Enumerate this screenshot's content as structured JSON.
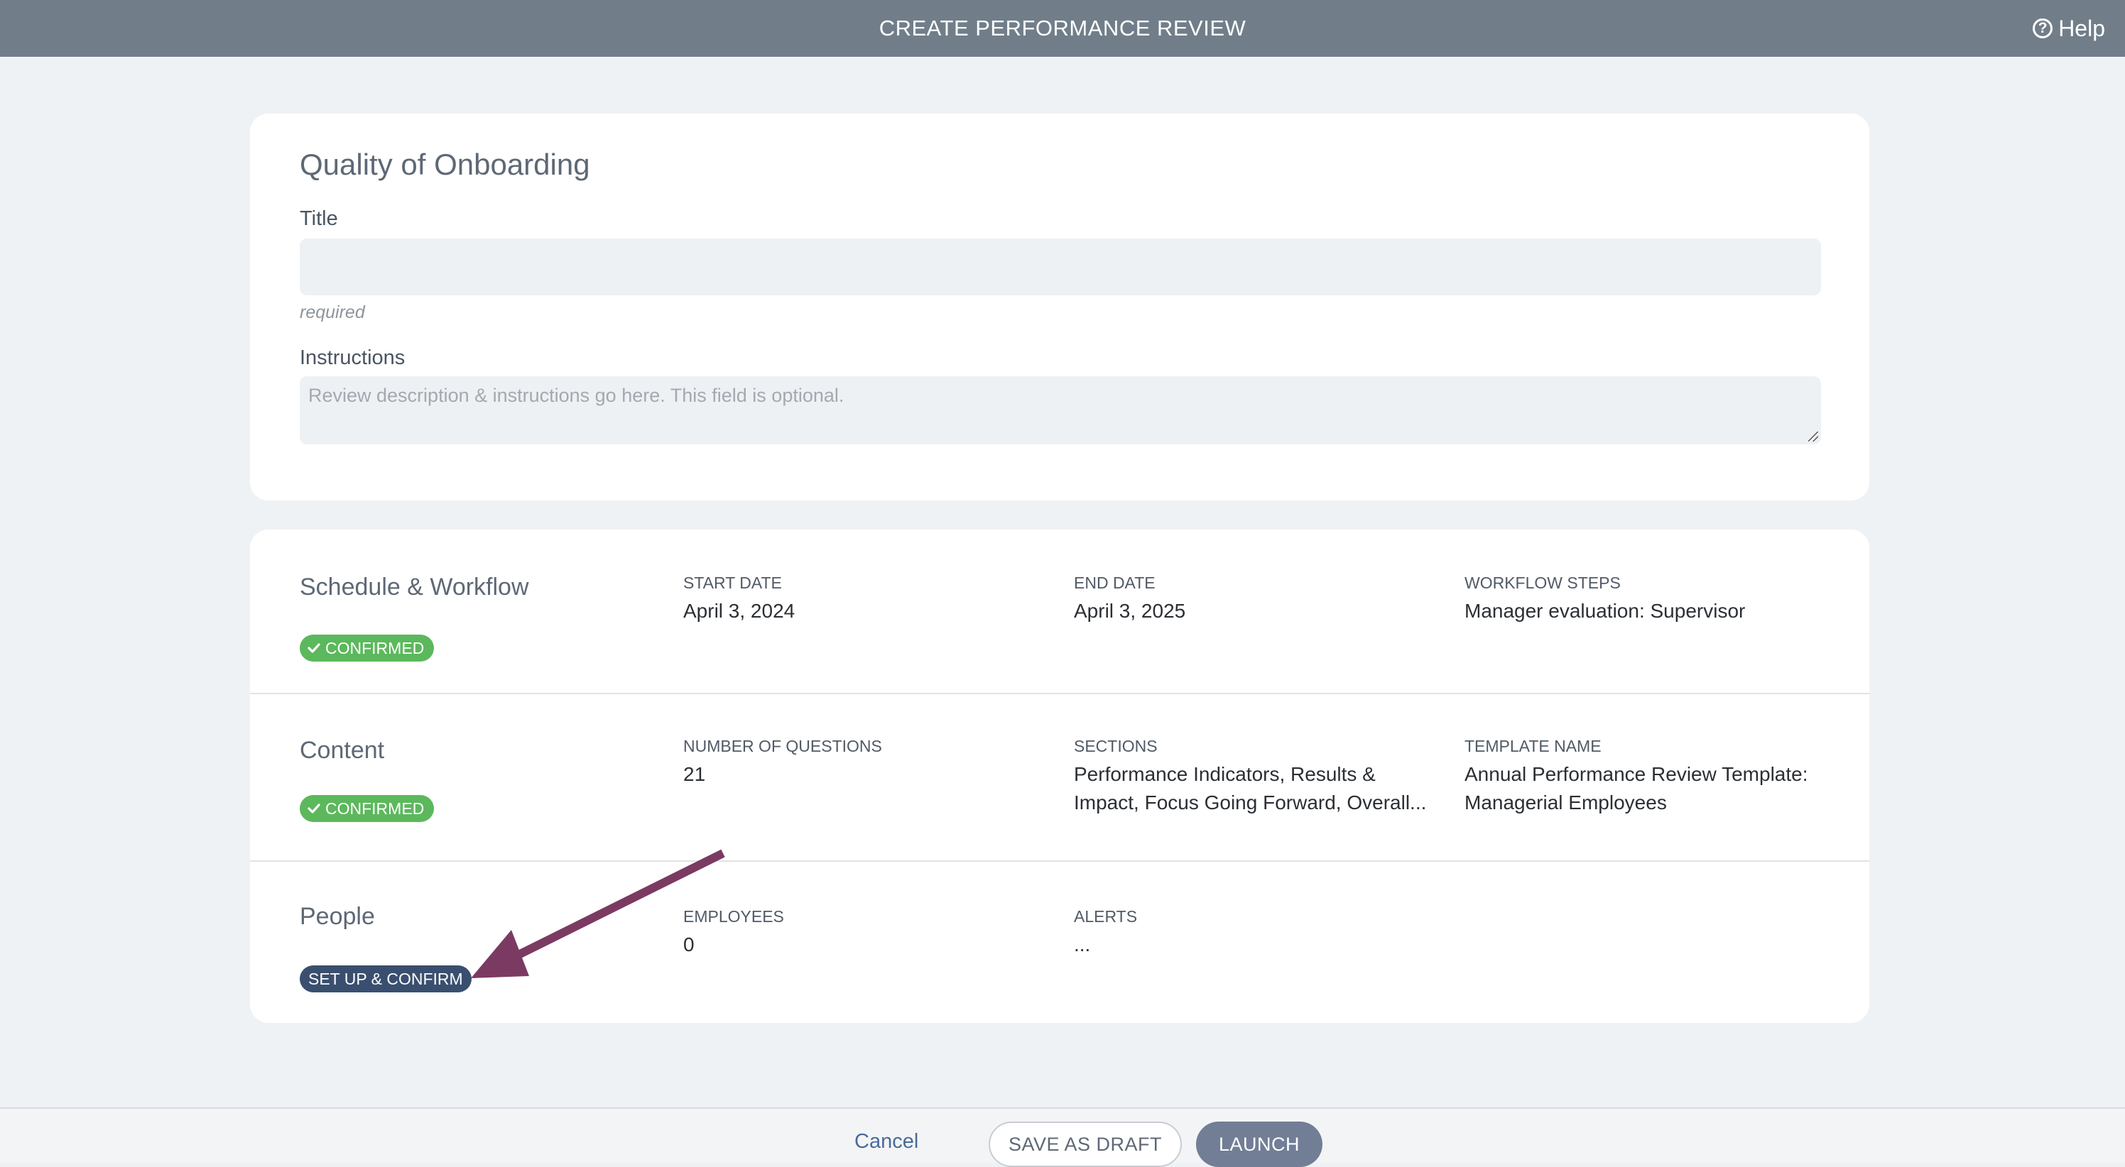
{
  "header": {
    "title": "CREATE PERFORMANCE REVIEW",
    "help_label": "Help",
    "help_icon": "question-circle-icon"
  },
  "review": {
    "name": "Quality of Onboarding",
    "title_label": "Title",
    "title_value": "",
    "title_note": "required",
    "instructions_label": "Instructions",
    "instructions_placeholder": "Review description & instructions go here.  This field is optional."
  },
  "sections": {
    "schedule": {
      "title": "Schedule & Workflow",
      "status": "CONFIRMED",
      "start_date_label": "START DATE",
      "start_date": "April 3, 2024",
      "end_date_label": "END DATE",
      "end_date": "April 3, 2025",
      "workflow_label": "WORKFLOW STEPS",
      "workflow": "Manager evaluation: Supervisor"
    },
    "content": {
      "title": "Content",
      "status": "CONFIRMED",
      "questions_label": "NUMBER OF QUESTIONS",
      "questions": "21",
      "sections_label": "SECTIONS",
      "sections_value": "Performance Indicators, Results & Impact, Focus Going Forward, Overall...",
      "template_label": "TEMPLATE NAME",
      "template": "Annual Performance Review Template: Managerial Employees"
    },
    "people": {
      "title": "People",
      "status": "SET UP & CONFIRM",
      "employees_label": "EMPLOYEES",
      "employees": "0",
      "alerts_label": "ALERTS",
      "alerts": "..."
    }
  },
  "footer": {
    "cancel_label": "Cancel",
    "draft_label": "SAVE AS DRAFT",
    "launch_label": "LAUNCH"
  },
  "colors": {
    "topbar": "#717e8a",
    "confirmed": "#5cb85c",
    "setup": "#3a4f6f",
    "annotation_arrow": "#7b3a62"
  }
}
